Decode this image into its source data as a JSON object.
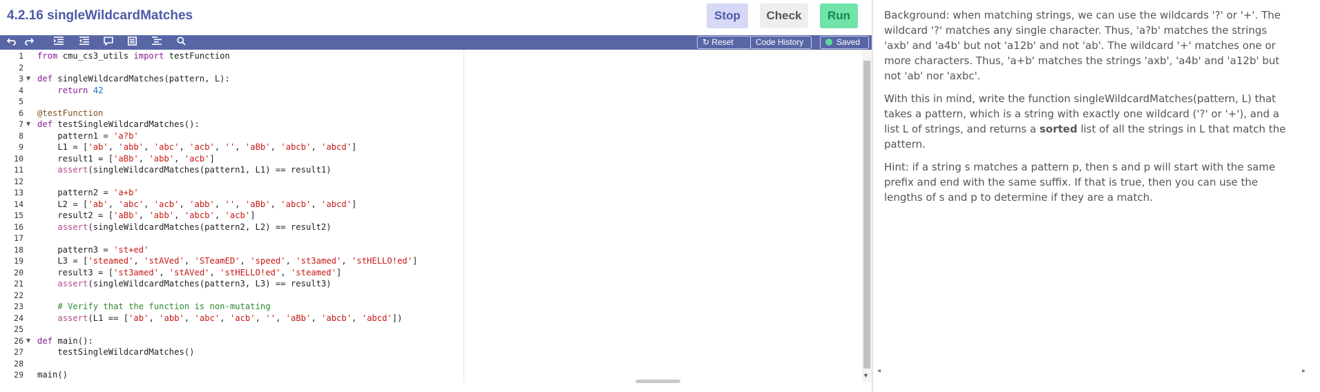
{
  "header": {
    "title": "4.2.16 singleWildcardMatches",
    "stop_label": "Stop",
    "check_label": "Check",
    "run_label": "Run"
  },
  "toolbar": {
    "icons": [
      "undo-icon",
      "redo-icon",
      "indent-icon",
      "outdent-icon",
      "comment-icon",
      "format-icon",
      "list-icon",
      "search-icon"
    ],
    "reset_label": "Reset",
    "reset_glyph": "↻",
    "history_label": "Code History",
    "saved_label": "Saved"
  },
  "editor": {
    "lines": [
      {
        "n": "1",
        "fold": false,
        "tokens": [
          {
            "t": "from",
            "c": "kw"
          },
          {
            "t": " cmu_cs3_utils ",
            "c": ""
          },
          {
            "t": "import",
            "c": "kw"
          },
          {
            "t": " testFunction",
            "c": ""
          }
        ]
      },
      {
        "n": "2",
        "fold": false,
        "tokens": []
      },
      {
        "n": "3",
        "fold": true,
        "tokens": [
          {
            "t": "def",
            "c": "kw"
          },
          {
            "t": " singleWildcardMatches(pattern, L):",
            "c": ""
          }
        ]
      },
      {
        "n": "4",
        "fold": false,
        "tokens": [
          {
            "t": "    ",
            "c": ""
          },
          {
            "t": "return",
            "c": "kw"
          },
          {
            "t": " ",
            "c": ""
          },
          {
            "t": "42",
            "c": "num"
          }
        ]
      },
      {
        "n": "5",
        "fold": false,
        "tokens": []
      },
      {
        "n": "6",
        "fold": false,
        "tokens": [
          {
            "t": "@testFunction",
            "c": "dec"
          }
        ]
      },
      {
        "n": "7",
        "fold": true,
        "tokens": [
          {
            "t": "def",
            "c": "kw"
          },
          {
            "t": " testSingleWildcardMatches():",
            "c": ""
          }
        ]
      },
      {
        "n": "8",
        "fold": false,
        "tokens": [
          {
            "t": "    pattern1 = ",
            "c": ""
          },
          {
            "t": "'a?b'",
            "c": "str"
          }
        ]
      },
      {
        "n": "9",
        "fold": false,
        "tokens": [
          {
            "t": "    L1 = [",
            "c": ""
          },
          {
            "t": "'ab'",
            "c": "str"
          },
          {
            "t": ", ",
            "c": ""
          },
          {
            "t": "'abb'",
            "c": "str"
          },
          {
            "t": ", ",
            "c": ""
          },
          {
            "t": "'abc'",
            "c": "str"
          },
          {
            "t": ", ",
            "c": ""
          },
          {
            "t": "'acb'",
            "c": "str"
          },
          {
            "t": ", ",
            "c": ""
          },
          {
            "t": "''",
            "c": "str"
          },
          {
            "t": ", ",
            "c": ""
          },
          {
            "t": "'aBb'",
            "c": "str"
          },
          {
            "t": ", ",
            "c": ""
          },
          {
            "t": "'abcb'",
            "c": "str"
          },
          {
            "t": ", ",
            "c": ""
          },
          {
            "t": "'abcd'",
            "c": "str"
          },
          {
            "t": "]",
            "c": ""
          }
        ]
      },
      {
        "n": "10",
        "fold": false,
        "tokens": [
          {
            "t": "    result1 = [",
            "c": ""
          },
          {
            "t": "'aBb'",
            "c": "str"
          },
          {
            "t": ", ",
            "c": ""
          },
          {
            "t": "'abb'",
            "c": "str"
          },
          {
            "t": ", ",
            "c": ""
          },
          {
            "t": "'acb'",
            "c": "str"
          },
          {
            "t": "]",
            "c": ""
          }
        ]
      },
      {
        "n": "11",
        "fold": false,
        "tokens": [
          {
            "t": "    ",
            "c": ""
          },
          {
            "t": "assert",
            "c": "fn"
          },
          {
            "t": "(singleWildcardMatches(pattern1, L1) == result1)",
            "c": ""
          }
        ]
      },
      {
        "n": "12",
        "fold": false,
        "tokens": []
      },
      {
        "n": "13",
        "fold": false,
        "tokens": [
          {
            "t": "    pattern2 = ",
            "c": ""
          },
          {
            "t": "'a+b'",
            "c": "str"
          }
        ]
      },
      {
        "n": "14",
        "fold": false,
        "tokens": [
          {
            "t": "    L2 = [",
            "c": ""
          },
          {
            "t": "'ab'",
            "c": "str"
          },
          {
            "t": ", ",
            "c": ""
          },
          {
            "t": "'abc'",
            "c": "str"
          },
          {
            "t": ", ",
            "c": ""
          },
          {
            "t": "'acb'",
            "c": "str"
          },
          {
            "t": ", ",
            "c": ""
          },
          {
            "t": "'abb'",
            "c": "str"
          },
          {
            "t": ", ",
            "c": ""
          },
          {
            "t": "''",
            "c": "str"
          },
          {
            "t": ", ",
            "c": ""
          },
          {
            "t": "'aBb'",
            "c": "str"
          },
          {
            "t": ", ",
            "c": ""
          },
          {
            "t": "'abcb'",
            "c": "str"
          },
          {
            "t": ", ",
            "c": ""
          },
          {
            "t": "'abcd'",
            "c": "str"
          },
          {
            "t": "]",
            "c": ""
          }
        ]
      },
      {
        "n": "15",
        "fold": false,
        "tokens": [
          {
            "t": "    result2 = [",
            "c": ""
          },
          {
            "t": "'aBb'",
            "c": "str"
          },
          {
            "t": ", ",
            "c": ""
          },
          {
            "t": "'abb'",
            "c": "str"
          },
          {
            "t": ", ",
            "c": ""
          },
          {
            "t": "'abcb'",
            "c": "str"
          },
          {
            "t": ", ",
            "c": ""
          },
          {
            "t": "'acb'",
            "c": "str"
          },
          {
            "t": "]",
            "c": ""
          }
        ]
      },
      {
        "n": "16",
        "fold": false,
        "tokens": [
          {
            "t": "    ",
            "c": ""
          },
          {
            "t": "assert",
            "c": "fn"
          },
          {
            "t": "(singleWildcardMatches(pattern2, L2) == result2)",
            "c": ""
          }
        ]
      },
      {
        "n": "17",
        "fold": false,
        "tokens": []
      },
      {
        "n": "18",
        "fold": false,
        "tokens": [
          {
            "t": "    pattern3 = ",
            "c": ""
          },
          {
            "t": "'st+ed'",
            "c": "str"
          }
        ]
      },
      {
        "n": "19",
        "fold": false,
        "tokens": [
          {
            "t": "    L3 = [",
            "c": ""
          },
          {
            "t": "'steamed'",
            "c": "str"
          },
          {
            "t": ", ",
            "c": ""
          },
          {
            "t": "'stAVed'",
            "c": "str"
          },
          {
            "t": ", ",
            "c": ""
          },
          {
            "t": "'STeamED'",
            "c": "str"
          },
          {
            "t": ", ",
            "c": ""
          },
          {
            "t": "'speed'",
            "c": "str"
          },
          {
            "t": ", ",
            "c": ""
          },
          {
            "t": "'st3amed'",
            "c": "str"
          },
          {
            "t": ", ",
            "c": ""
          },
          {
            "t": "'stHELLO!ed'",
            "c": "str"
          },
          {
            "t": "]",
            "c": ""
          }
        ]
      },
      {
        "n": "20",
        "fold": false,
        "tokens": [
          {
            "t": "    result3 = [",
            "c": ""
          },
          {
            "t": "'st3amed'",
            "c": "str"
          },
          {
            "t": ", ",
            "c": ""
          },
          {
            "t": "'stAVed'",
            "c": "str"
          },
          {
            "t": ", ",
            "c": ""
          },
          {
            "t": "'stHELLO!ed'",
            "c": "str"
          },
          {
            "t": ", ",
            "c": ""
          },
          {
            "t": "'steamed'",
            "c": "str"
          },
          {
            "t": "]",
            "c": ""
          }
        ]
      },
      {
        "n": "21",
        "fold": false,
        "tokens": [
          {
            "t": "    ",
            "c": ""
          },
          {
            "t": "assert",
            "c": "fn"
          },
          {
            "t": "(singleWildcardMatches(pattern3, L3) == result3)",
            "c": ""
          }
        ]
      },
      {
        "n": "22",
        "fold": false,
        "tokens": []
      },
      {
        "n": "23",
        "fold": false,
        "tokens": [
          {
            "t": "    ",
            "c": ""
          },
          {
            "t": "# Verify that the function is non-mutating",
            "c": "cmt"
          }
        ]
      },
      {
        "n": "24",
        "fold": false,
        "tokens": [
          {
            "t": "    ",
            "c": ""
          },
          {
            "t": "assert",
            "c": "fn"
          },
          {
            "t": "(L1 == [",
            "c": ""
          },
          {
            "t": "'ab'",
            "c": "str"
          },
          {
            "t": ", ",
            "c": ""
          },
          {
            "t": "'abb'",
            "c": "str"
          },
          {
            "t": ", ",
            "c": ""
          },
          {
            "t": "'abc'",
            "c": "str"
          },
          {
            "t": ", ",
            "c": ""
          },
          {
            "t": "'acb'",
            "c": "str"
          },
          {
            "t": ", ",
            "c": ""
          },
          {
            "t": "''",
            "c": "str"
          },
          {
            "t": ", ",
            "c": ""
          },
          {
            "t": "'aBb'",
            "c": "str"
          },
          {
            "t": ", ",
            "c": ""
          },
          {
            "t": "'abcb'",
            "c": "str"
          },
          {
            "t": ", ",
            "c": ""
          },
          {
            "t": "'abcd'",
            "c": "str"
          },
          {
            "t": "])",
            "c": ""
          }
        ]
      },
      {
        "n": "25",
        "fold": false,
        "tokens": []
      },
      {
        "n": "26",
        "fold": true,
        "tokens": [
          {
            "t": "def",
            "c": "kw"
          },
          {
            "t": " main():",
            "c": ""
          }
        ]
      },
      {
        "n": "27",
        "fold": false,
        "tokens": [
          {
            "t": "    testSingleWildcardMatches()",
            "c": ""
          }
        ]
      },
      {
        "n": "28",
        "fold": false,
        "tokens": []
      },
      {
        "n": "29",
        "fold": false,
        "tokens": [
          {
            "t": "main()",
            "c": ""
          }
        ]
      }
    ]
  },
  "instructions": {
    "p1": "Background: when matching strings, we can use the wildcards '?' or '+'. The wildcard '?' matches any single character. Thus, 'a?b' matches the strings 'axb' and 'a4b' but not 'a12b' and not 'ab'. The wildcard '+' matches one or more characters. Thus, 'a+b' matches the strings 'axb', 'a4b' and 'a12b' but not 'ab' nor 'axbc'.",
    "p2_before": "With this in mind, write the function singleWildcardMatches(pattern, L) that takes a pattern, which is a string with exactly one wildcard ('?' or '+'), and a list L of strings, and returns a ",
    "p2_bold": "sorted",
    "p2_after": " list of all the strings in L that match the pattern.",
    "p3": "Hint: if a string s matches a pattern p, then s and p will start with the same prefix and end with the same suffix. If that is true, then you can use the lengths of s and p to determine if they are a match."
  },
  "colors": {
    "accent": "#4c5aa6",
    "toolbar": "#5866a6",
    "run": "#6fe3a8",
    "stop": "#d6d8f5"
  }
}
